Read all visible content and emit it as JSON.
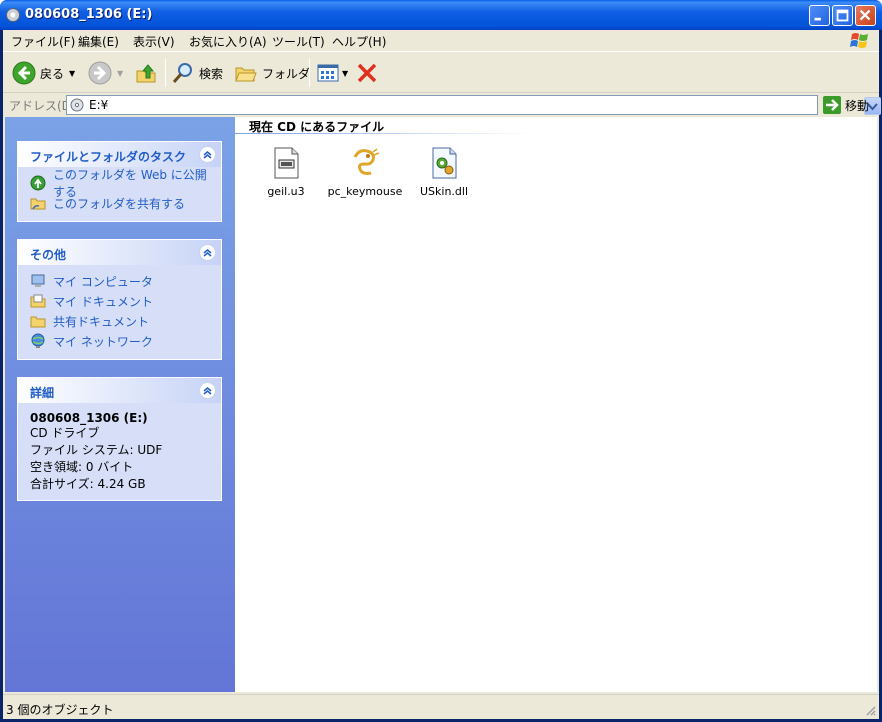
{
  "window": {
    "title": "080608_1306 (E:)",
    "icon": "cd-drive-icon"
  },
  "menu": {
    "items": [
      "ファイル(F)",
      "編集(E)",
      "表示(V)",
      "お気に入り(A)",
      "ツール(T)",
      "ヘルプ(H)"
    ]
  },
  "toolbar": {
    "back_label": "戻る",
    "search_label": "検索",
    "folders_label": "フォルダ"
  },
  "address": {
    "label": "アドレス(D)",
    "value": "E:¥",
    "go_label": "移動"
  },
  "sidebar": {
    "tasks_panel": {
      "title": "ファイルとフォルダのタスク",
      "items": [
        "このフォルダを Web に公開する",
        "このフォルダを共有する"
      ]
    },
    "other_panel": {
      "title": "その他",
      "items": [
        "マイ コンピュータ",
        "マイ ドキュメント",
        "共有ドキュメント",
        "マイ ネットワーク"
      ]
    },
    "details_panel": {
      "title": "詳細",
      "name": "080608_1306 (E:)",
      "type": "CD ドライブ",
      "filesystem": "ファイル システム: UDF",
      "free": "空き領域: 0 バイト",
      "total": "合計サイズ: 4.24 GB"
    }
  },
  "content": {
    "group_title": "現在 CD にあるファイル",
    "files": [
      {
        "name": "geil.u3",
        "icon": "unknown-file-icon"
      },
      {
        "name": "pc_keymouse",
        "icon": "dragon-app-icon"
      },
      {
        "name": "USkin.dll",
        "icon": "dll-file-icon"
      }
    ]
  },
  "status": {
    "text": "3 個のオブジェクト"
  }
}
